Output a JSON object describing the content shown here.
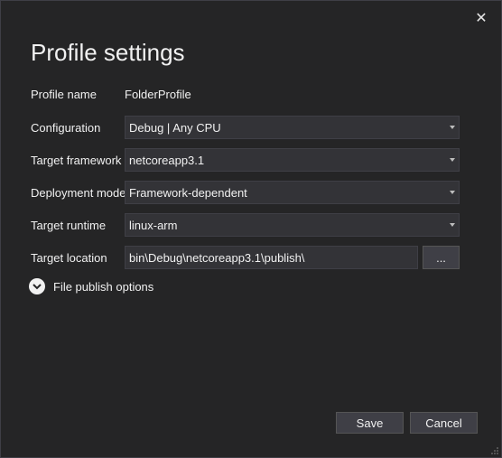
{
  "dialog": {
    "title": "Profile settings",
    "close_icon": "close-icon",
    "close_glyph": "✕"
  },
  "form": {
    "profile_name": {
      "label": "Profile name",
      "value": "FolderProfile"
    },
    "configuration": {
      "label": "Configuration",
      "value": "Debug | Any CPU"
    },
    "target_framework": {
      "label": "Target framework",
      "value": "netcoreapp3.1"
    },
    "deployment_mode": {
      "label": "Deployment mode",
      "value": "Framework-dependent"
    },
    "target_runtime": {
      "label": "Target runtime",
      "value": "linux-arm"
    },
    "target_location": {
      "label": "Target location",
      "value": "bin\\Debug\\netcoreapp3.1\\publish\\",
      "browse_label": "..."
    }
  },
  "expander": {
    "label": "File publish options",
    "icon": "chevron-down-circle-icon"
  },
  "footer": {
    "save_label": "Save",
    "cancel_label": "Cancel"
  },
  "colors": {
    "background": "#252526",
    "field_background": "#333337",
    "button_background": "#3f3f46",
    "text": "#f1f1f1"
  }
}
